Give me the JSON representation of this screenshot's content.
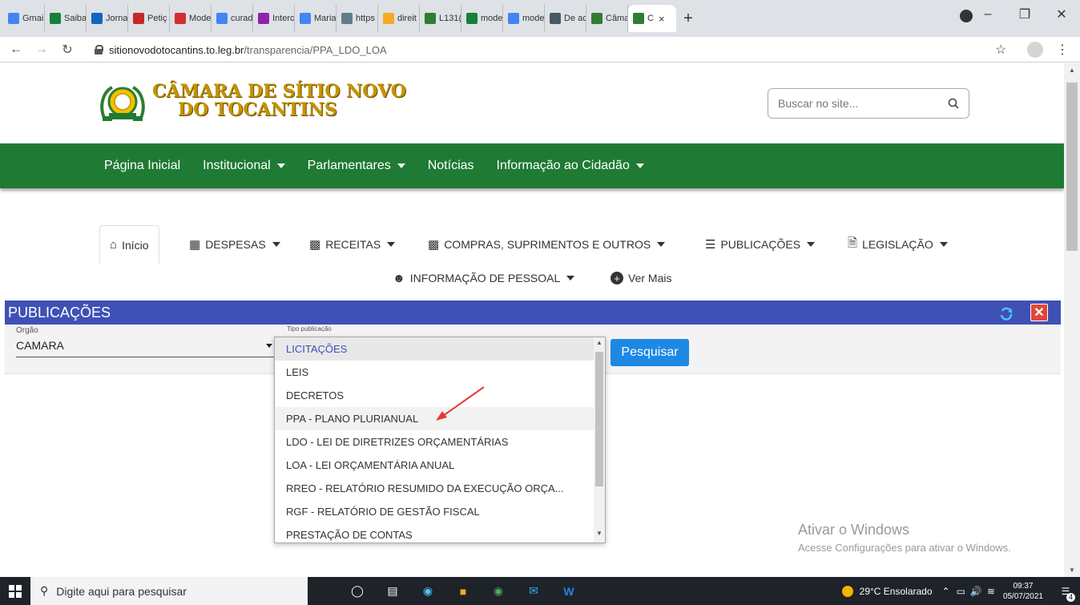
{
  "browser": {
    "tabs": [
      {
        "label": "Gmai",
        "icon": "google-icon",
        "color": "#4285f4"
      },
      {
        "label": "Saiba",
        "icon": "drive-icon",
        "color": "#188038"
      },
      {
        "label": "Jorna",
        "icon": "news-icon",
        "color": "#1565c0"
      },
      {
        "label": "Petiç",
        "icon": "document-icon",
        "color": "#c62828"
      },
      {
        "label": "Mode",
        "icon": "diamond-icon",
        "color": "#d32f2f"
      },
      {
        "label": "curad",
        "icon": "google-icon",
        "color": "#4285f4"
      },
      {
        "label": "Interc",
        "icon": "law-icon",
        "color": "#8e24aa"
      },
      {
        "label": "Maria",
        "icon": "google-icon",
        "color": "#4285f4"
      },
      {
        "label": "https",
        "icon": "page-icon",
        "color": "#607d8b"
      },
      {
        "label": "direit",
        "icon": "folder-icon",
        "color": "#f9a825"
      },
      {
        "label": "L131(",
        "icon": "flag-icon",
        "color": "#2e7d32"
      },
      {
        "label": "mode",
        "icon": "drive-icon",
        "color": "#188038"
      },
      {
        "label": "mode",
        "icon": "google-icon",
        "color": "#4285f4"
      },
      {
        "label": "De ac",
        "icon": "globe-icon",
        "color": "#455a64"
      },
      {
        "label": "Câma",
        "icon": "camara-icon",
        "color": "#2e7d32"
      },
      {
        "label": "C",
        "icon": "camara-icon",
        "color": "#2e7d32"
      }
    ],
    "new_tab": "+",
    "url_host": "sitionovodotocantins.to.leg.br",
    "url_path": "/transparencia/PPA_LDO_LOA"
  },
  "site": {
    "logo_line1": "CÂMARA DE SÍTIO NOVO",
    "logo_line2": "DO TOCANTINS",
    "search_placeholder": "Buscar no site...",
    "main_nav": [
      {
        "label": "Página Inicial",
        "dropdown": false
      },
      {
        "label": "Institucional",
        "dropdown": true
      },
      {
        "label": "Parlamentares",
        "dropdown": true
      },
      {
        "label": "Notícias",
        "dropdown": false
      },
      {
        "label": "Informação ao Cidadão",
        "dropdown": true
      }
    ],
    "sub_nav": {
      "home": "Início",
      "despesas": "DESPESAS",
      "receitas": "RECEITAS",
      "compras": "COMPRAS, SUPRIMENTOS E OUTROS",
      "publicacoes": "PUBLICAÇÕES",
      "legislacao": "LEGISLAÇÃO",
      "pessoal": "INFORMAÇÃO DE PESSOAL",
      "ver_mais": "Ver Mais"
    }
  },
  "panel": {
    "title": "PUBLICAÇÕES",
    "orgao_label": "Orgão",
    "orgao_value": "CAMARA",
    "tipo_label": "Tipo publicação",
    "search_button": "Pesquisar",
    "options": [
      "LICITAÇÕES",
      "LEIS",
      "DECRETOS",
      "PPA - PLANO PLURIANUAL",
      "LDO - LEI DE DIRETRIZES ORÇAMENTÁRIAS",
      "LOA - LEI ORÇAMENTÁRIA ANUAL",
      "RREO - RELATÓRIO RESUMIDO DA EXECUÇÃO ORÇA...",
      "RGF - RELATÓRIO DE GESTÃO FISCAL",
      "PRESTAÇÃO DE CONTAS"
    ],
    "selected_option": "LICITAÇÕES",
    "highlighted_option": "PPA - PLANO PLURIANUAL"
  },
  "watermark": {
    "line1": "Ativar o Windows",
    "line2": "Acesse Configurações para ativar o Windows."
  },
  "taskbar": {
    "search_placeholder": "Digite aqui para pesquisar",
    "weather": "29°C  Ensolarado",
    "time": "09:37",
    "date": "05/07/2021",
    "notifications": "4"
  },
  "colors": {
    "green_bar": "#1f7a33",
    "panel_header": "#3f51b5",
    "search_button": "#1e88e5",
    "logo_gold": "#c59400",
    "annotation_arrow": "#e53935"
  }
}
